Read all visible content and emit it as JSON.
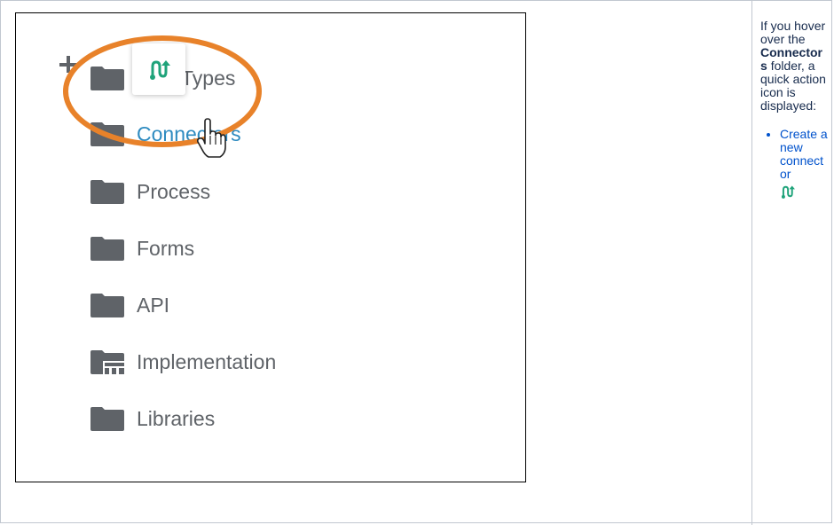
{
  "tree": {
    "items": [
      {
        "label": "Types",
        "icon": "folder-icon"
      },
      {
        "label": "Connectors",
        "icon": "folder-icon",
        "hovered": true
      },
      {
        "label": "Process",
        "icon": "folder-icon"
      },
      {
        "label": "Forms",
        "icon": "folder-icon"
      },
      {
        "label": "API",
        "icon": "folder-icon"
      },
      {
        "label": "Implementation",
        "icon": "implementation-folder-icon"
      },
      {
        "label": "Libraries",
        "icon": "folder-icon"
      }
    ]
  },
  "popover": {
    "icon": "connector-icon"
  },
  "description": {
    "prefix": "If you hover over the",
    "bold": "Connectors",
    "suffix": "folder, a quick action icon is displayed:",
    "list": [
      {
        "text": "Create a new connector",
        "icon": "connector-icon"
      }
    ]
  },
  "colors": {
    "folder": "#5f6368",
    "label": "#5f6368",
    "label_hover": "#2e8bc0",
    "highlight_ring": "#e8822a",
    "connector_icon": "#1fa37a",
    "link": "#0052cc",
    "border": "#c1c7d0"
  }
}
